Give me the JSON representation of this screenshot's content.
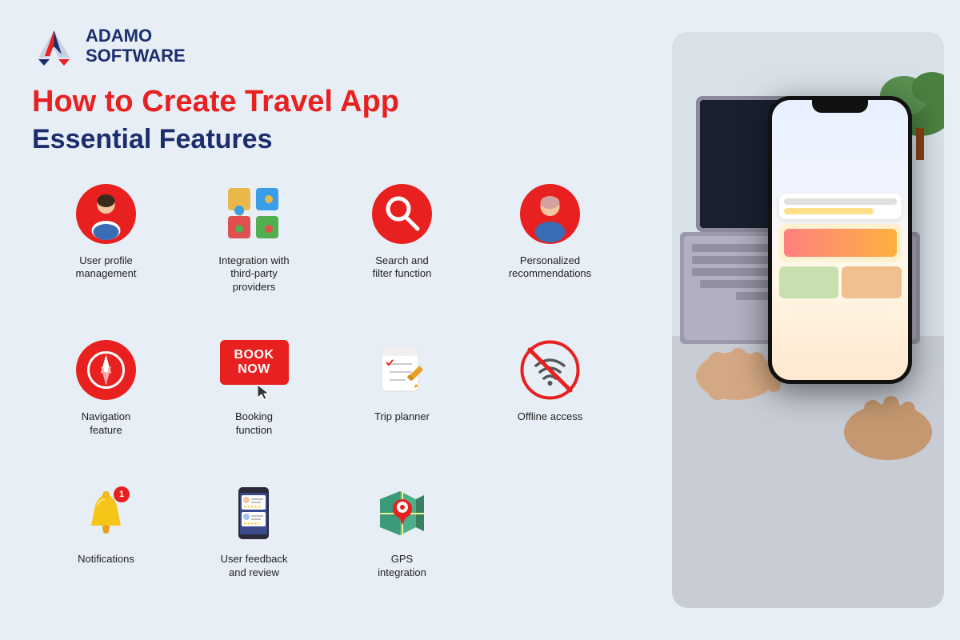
{
  "logo": {
    "name_line1": "ADAMO",
    "name_line2": "SOFTWARE"
  },
  "headline": "How to Create Travel App",
  "subheadline": "Essential Features",
  "features": [
    {
      "id": "user-profile",
      "label": "User profile management",
      "icon_type": "user"
    },
    {
      "id": "integration",
      "label": "Integration with third-party providers",
      "icon_type": "puzzle"
    },
    {
      "id": "search",
      "label": "Search and filter function",
      "icon_type": "search"
    },
    {
      "id": "personalized",
      "label": "Personalized recommendations",
      "icon_type": "person-circle"
    },
    {
      "id": "navigation",
      "label": "Navigation feature",
      "icon_type": "compass"
    },
    {
      "id": "booking",
      "label": "Booking function",
      "icon_type": "book-now"
    },
    {
      "id": "trip-planner",
      "label": "Trip planner",
      "icon_type": "planner"
    },
    {
      "id": "offline",
      "label": "Offline access",
      "icon_type": "wifi-off"
    },
    {
      "id": "notifications",
      "label": "Notifications",
      "icon_type": "bell"
    },
    {
      "id": "feedback",
      "label": "User feedback and review",
      "icon_type": "review"
    },
    {
      "id": "gps",
      "label": "GPS integration",
      "icon_type": "gps"
    },
    {
      "id": "empty",
      "label": "",
      "icon_type": "none"
    }
  ],
  "book_now_label": "BOOK NOW",
  "badge_count": "1",
  "colors": {
    "red": "#e82020",
    "navy": "#1a2e6e",
    "background": "#e8eef5"
  }
}
